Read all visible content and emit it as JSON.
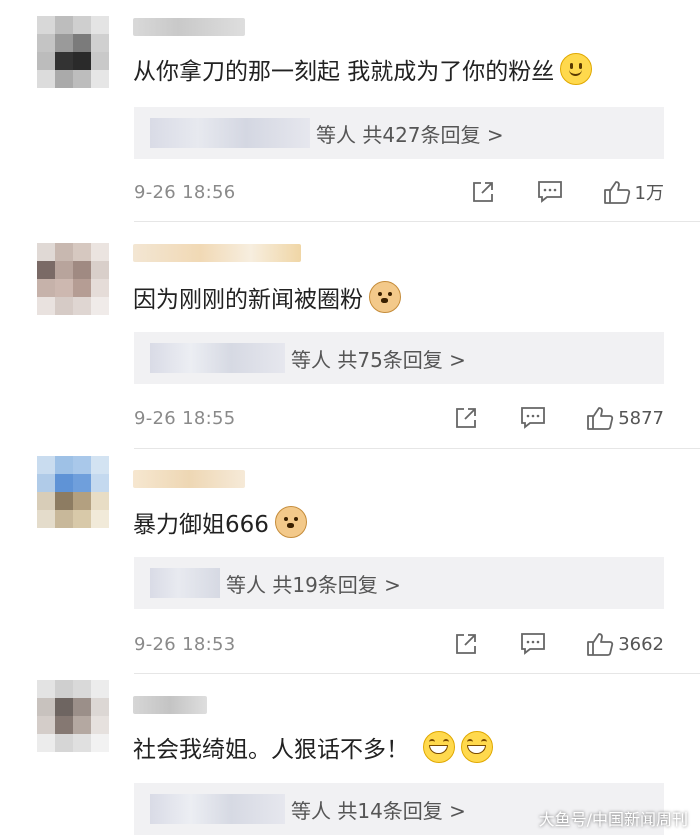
{
  "comments": [
    {
      "text": "从你拿刀的那一刻起 我就成为了你的粉丝",
      "emoji": "slight-smile-emoji",
      "reply_summary": "等人 共427条回复 >",
      "time": "9-26 18:56",
      "likes": "1万"
    },
    {
      "text": "因为刚刚的新闻被圈粉",
      "emoji": "doge-emoji",
      "reply_summary": "等人 共75条回复 >",
      "time": "9-26 18:55",
      "likes": "5877"
    },
    {
      "text": "暴力御姐666",
      "emoji": "doge-emoji",
      "reply_summary": "等人 共19条回复 >",
      "time": "9-26 18:53",
      "likes": "3662"
    },
    {
      "text": "社会我绮姐。人狠话不多！",
      "emoji": "grin-emoji",
      "reply_summary": "等人 共14条回复 >",
      "time": "",
      "likes": ""
    }
  ],
  "watermark": "大鱼号/中国新闻周刊",
  "icons": {
    "share": "share-icon",
    "comment": "comment-icon",
    "like": "thumbs-up-icon"
  }
}
